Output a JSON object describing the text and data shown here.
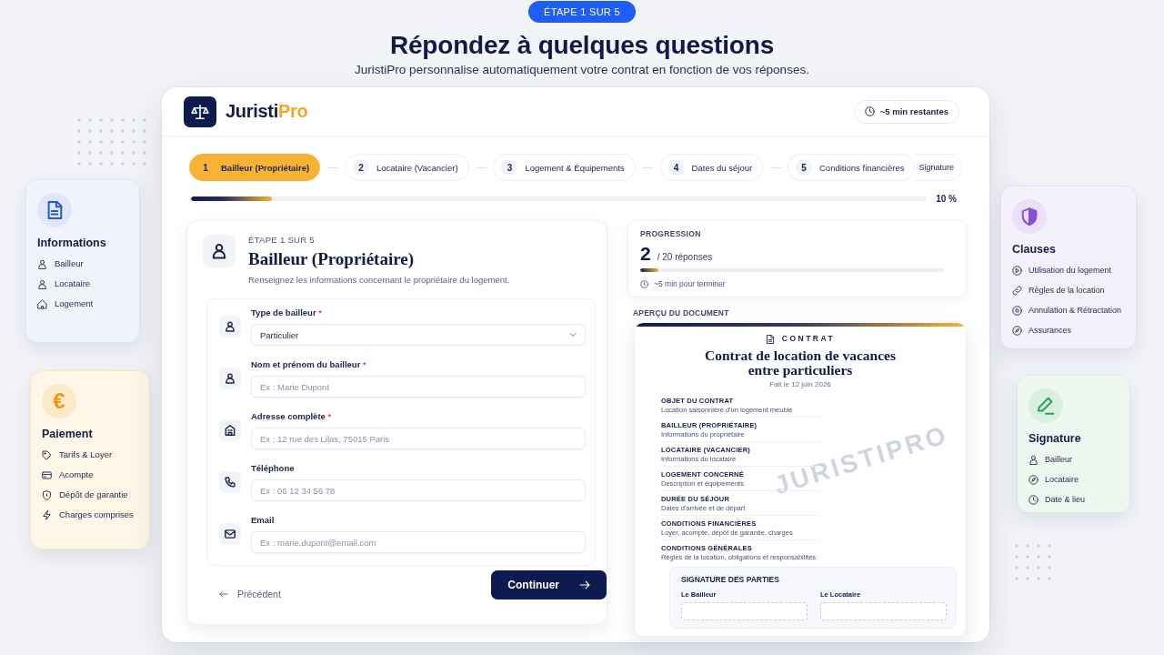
{
  "header": {
    "badge": "ÉTAPE 1 SUR 5",
    "title": "Répondez à quelques questions",
    "subtitle": "JuristiPro personnalise automatiquement votre contrat en fonction de vos réponses."
  },
  "left_cards": [
    {
      "kind": "information",
      "title": "Informations",
      "items": [
        "Bailleur",
        "Locataire",
        "Logement"
      ]
    },
    {
      "kind": "payment",
      "symbol": "€",
      "title": "Paiement",
      "items": [
        "Tarifs & Loyer",
        "Acompte",
        "Dépôt de garantie",
        "Charges comprises"
      ]
    }
  ],
  "app": {
    "brand": {
      "name": "Juristi",
      "accent": "Pro"
    },
    "time_left": "~5 min restantes",
    "steps": [
      {
        "number": "1",
        "label": "Bailleur (Propriétaire)",
        "selected": true
      },
      {
        "number": "2",
        "label": "Locataire (Vacancier)",
        "selected": false
      },
      {
        "number": "3",
        "label": "Logement & Équipements",
        "selected": false
      },
      {
        "number": "4",
        "label": "Dates du séjour",
        "selected": false
      },
      {
        "number": "5",
        "label": "Conditions financières",
        "selected": false
      },
      {
        "label": "Signature",
        "selected": false
      }
    ],
    "progress": {
      "level": 0.11,
      "reading": "10 %"
    },
    "form": {
      "eyebrow": "ÉTAPE 1 SUR 5",
      "title": "Bailleur (Propriétaire)",
      "description": "Renseignez les informations concernant le propriétaire du logement.",
      "fields": [
        {
          "kind": "select",
          "label": "Type de bailleur",
          "marker": "*",
          "value": "Particulier"
        },
        {
          "kind": "text",
          "label": "Nom et prénom du bailleur",
          "marker": "*",
          "placeholder": "Ex : Marie Dupont"
        },
        {
          "kind": "text",
          "label": "Adresse complète",
          "marker": "*",
          "placeholder": "Ex : 12 rue des Lilas, 75015 Paris"
        },
        {
          "kind": "text",
          "label": "Téléphone",
          "placeholder": "Ex : 06 12 34 56 78"
        },
        {
          "kind": "text",
          "label": "Email",
          "placeholder": "Ex : marie.dupont@email.com"
        }
      ],
      "back": "Précédent",
      "next": "Continuer"
    },
    "progression": {
      "label": "PROGRESSION",
      "count": "2",
      "total": "/ 20 réponses",
      "level": 0.06,
      "time": "~5 min pour terminer"
    },
    "preview": {
      "label": "APERÇU DU DOCUMENT",
      "kicker": "CONTRAT",
      "title": "Contrat de location de vacances entre particuliers",
      "date": "Fait le 12 juin 2026",
      "watermark": "JURISTIPRO",
      "sections": [
        {
          "heading": "OBJET DU CONTRAT",
          "text": "Location saisonnière d'un logement meublé"
        },
        {
          "heading": "BAILLEUR (PROPRIÉTAIRE)",
          "text": "Informations du propriétaire"
        },
        {
          "heading": "LOCATAIRE (VACANCIER)",
          "text": "Informations du locataire"
        },
        {
          "heading": "LOGEMENT CONCERNÉ",
          "text": "Description et équipements"
        },
        {
          "heading": "DURÉE DU SÉJOUR",
          "text": "Dates d'arrivée et de départ"
        },
        {
          "heading": "CONDITIONS FINANCIÈRES",
          "text": "Loyer, acompte, dépôt de garantie, charges"
        },
        {
          "heading": "CONDITIONS GÉNÉRALES",
          "text": "Règles de la location, obligations et responsabilités"
        }
      ],
      "signature": {
        "title": "SIGNATURE DES PARTIES",
        "parties": [
          "Le Bailleur",
          "Le Locataire"
        ]
      }
    }
  },
  "right_cards": [
    {
      "kind": "clauses",
      "title": "Clauses",
      "items": [
        "Utilisation du logement",
        "Règles de la location",
        "Annulation & Rétractation",
        "Assurances"
      ]
    },
    {
      "kind": "signature",
      "title": "Signature",
      "items": [
        "Bailleur",
        "Locataire",
        "Date & lieu"
      ]
    }
  ]
}
